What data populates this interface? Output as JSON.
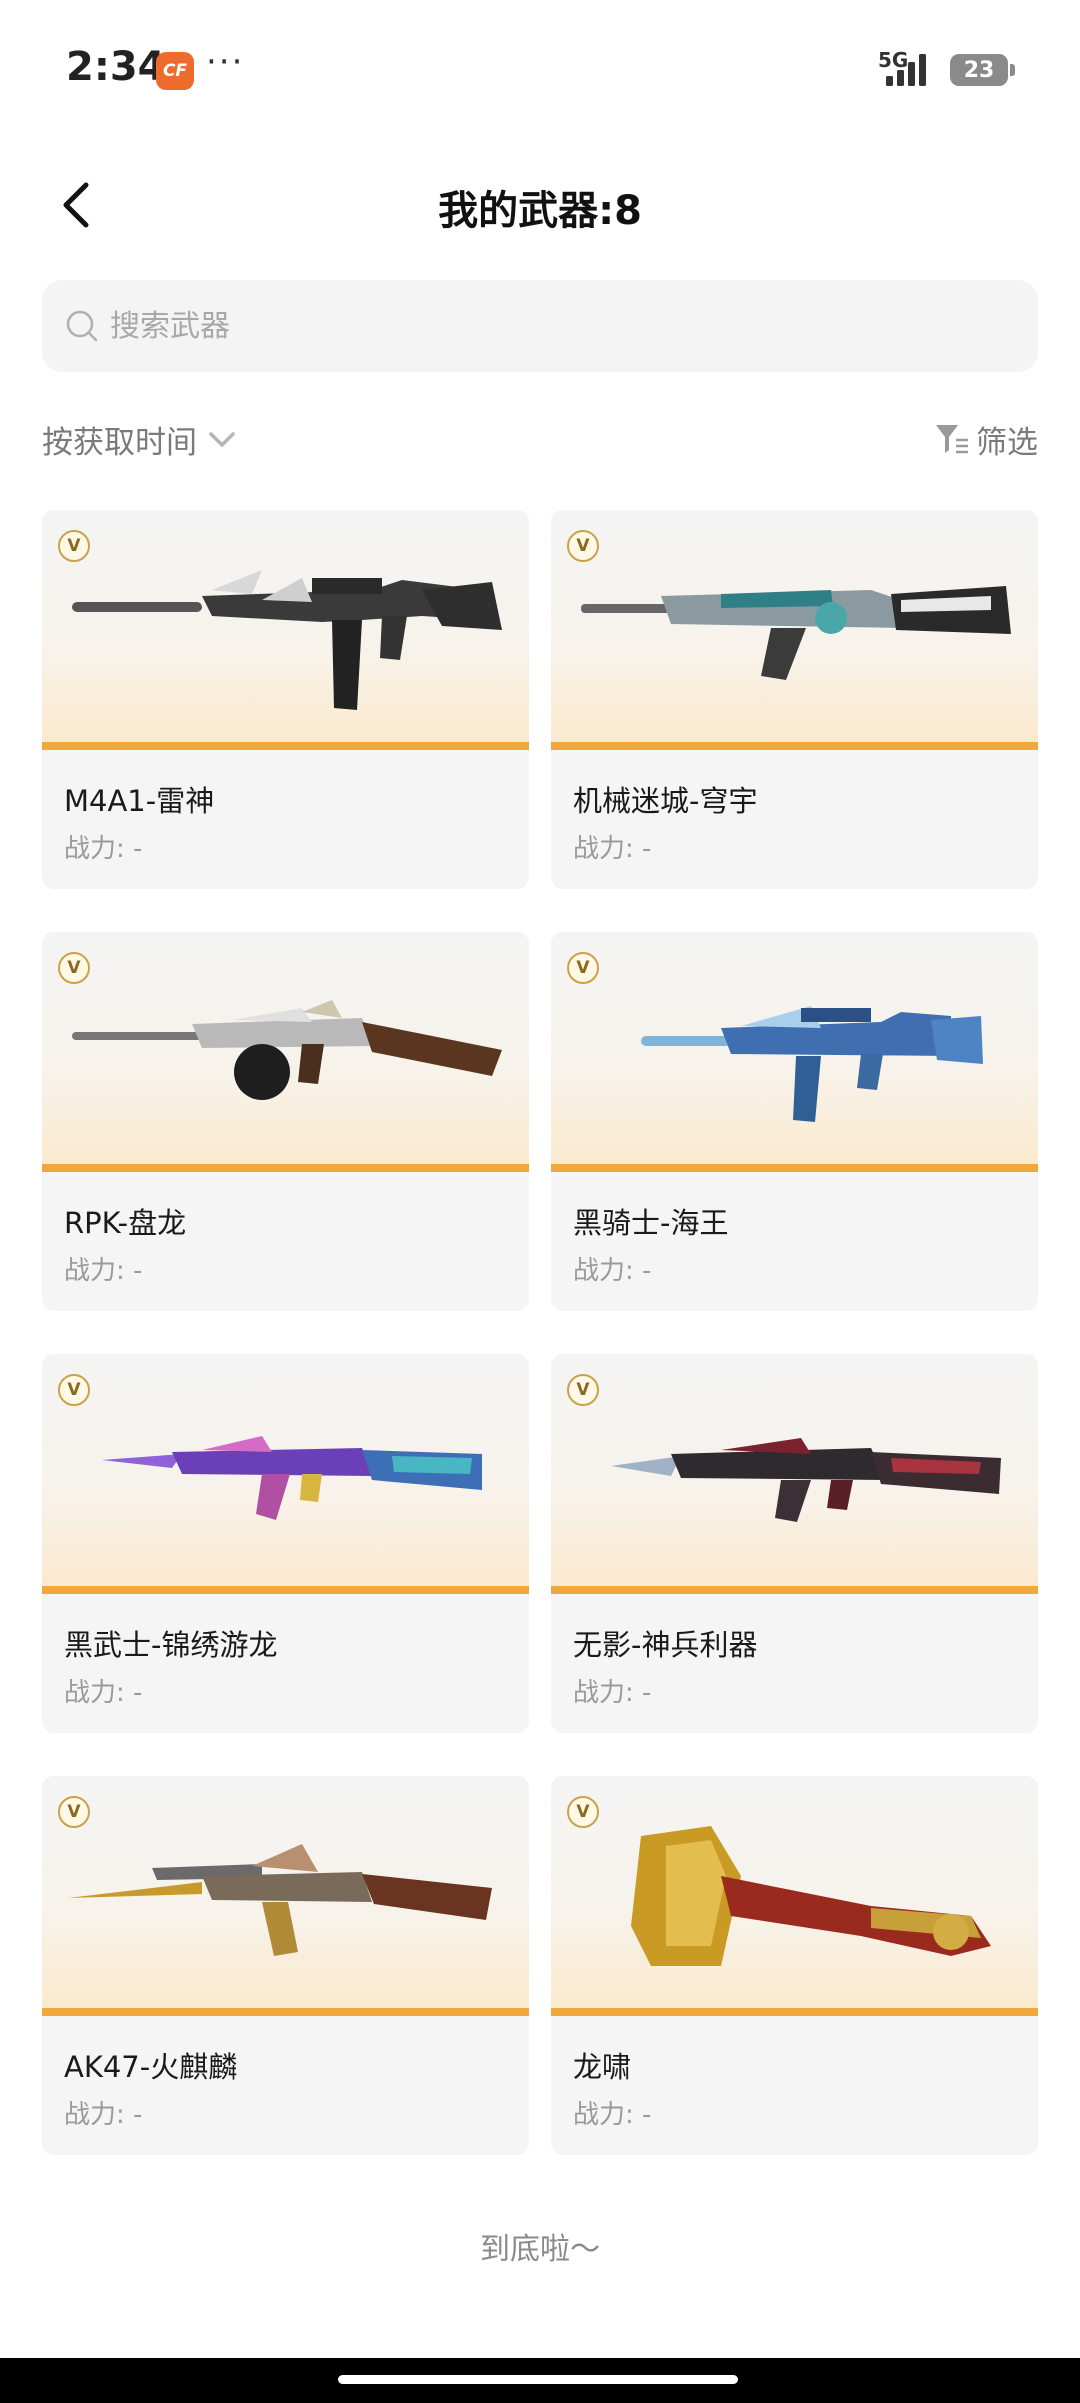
{
  "status_bar": {
    "time": "2:34",
    "app_badge": "CF",
    "more": "···",
    "network": "5G",
    "battery": "23"
  },
  "header": {
    "title": "我的武器:8"
  },
  "search": {
    "placeholder": "搜索武器"
  },
  "toolbar": {
    "sort_label": "按获取时间",
    "filter_label": "筛选"
  },
  "weapons": [
    {
      "name": "M4A1-雷神",
      "power": "战力: -",
      "badge": "V"
    },
    {
      "name": "机械迷城-穹宇",
      "power": "战力: -",
      "badge": "V"
    },
    {
      "name": "RPK-盘龙",
      "power": "战力: -",
      "badge": "V"
    },
    {
      "name": "黑骑士-海王",
      "power": "战力: -",
      "badge": "V"
    },
    {
      "name": "黑武士-锦绣游龙",
      "power": "战力: -",
      "badge": "V"
    },
    {
      "name": "无影-神兵利器",
      "power": "战力: -",
      "badge": "V"
    },
    {
      "name": "AK47-火麒麟",
      "power": "战力: -",
      "badge": "V"
    },
    {
      "name": "龙啸",
      "power": "战力: -",
      "badge": "V"
    }
  ],
  "footer": {
    "end_text": "到底啦～"
  },
  "colors": {
    "accent_bar": "#f0a83c",
    "card_bg": "#f5f5f5",
    "muted_text": "#9a9a9a"
  }
}
